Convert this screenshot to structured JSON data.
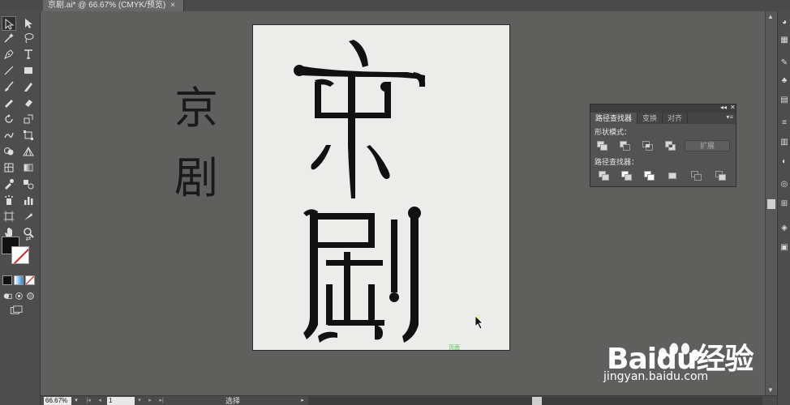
{
  "window": {
    "doc_tab_title": "京剧.ai* @ 66.67% (CMYK/预览)",
    "close_glyph": "×"
  },
  "reference_text": {
    "char1": "京",
    "char2": "剧"
  },
  "artboard": {
    "label": "页面"
  },
  "panel": {
    "tabs": [
      "路径查找器",
      "变换",
      "对齐"
    ],
    "section_shape_modes": "形状模式：",
    "section_pathfinders": "路径查找器：",
    "expand_label": "扩展"
  },
  "statusbar": {
    "zoom": "66.67%",
    "page": "1",
    "status": "选择"
  },
  "watermark": {
    "brand": "Baidu经验",
    "url": "jingyan.baidu.com"
  },
  "colors": {
    "fill": "#111111",
    "stroke": "#ffffff",
    "canvas_bg": "#5f605e",
    "artboard_bg": "#ecedea"
  }
}
